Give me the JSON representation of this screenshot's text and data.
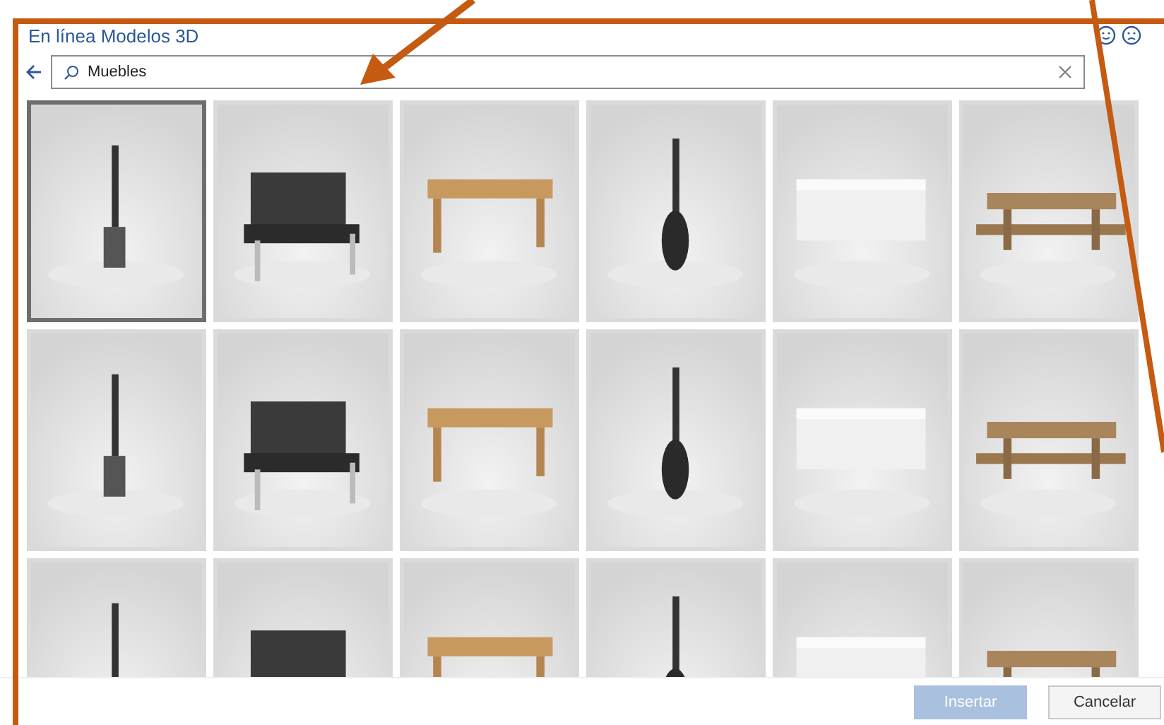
{
  "dialog": {
    "title": "En línea Modelos 3D"
  },
  "search": {
    "value": "Muebles"
  },
  "tiles": [
    {
      "kind": "picture",
      "selected": true
    },
    {
      "kind": "picture",
      "selected": false
    },
    {
      "kind": "picture",
      "selected": false
    },
    {
      "kind": "picture",
      "selected": false
    },
    {
      "kind": "picture",
      "selected": false
    },
    {
      "kind": "picture",
      "selected": false
    },
    {
      "kind": "picture",
      "selected": false
    },
    {
      "kind": "picture",
      "selected": false
    },
    {
      "kind": "picture",
      "selected": false
    },
    {
      "kind": "picture",
      "selected": false
    },
    {
      "kind": "picture",
      "selected": false
    },
    {
      "kind": "picture",
      "selected": false
    },
    {
      "kind": "picture",
      "selected": false
    },
    {
      "kind": "picture",
      "selected": false
    },
    {
      "kind": "picture",
      "selected": false
    },
    {
      "kind": "picture",
      "selected": false
    },
    {
      "kind": "picture",
      "selected": false
    },
    {
      "kind": "picture",
      "selected": false
    }
  ],
  "buttons": [
    {
      "label": "Insertar",
      "disabled": true
    },
    {
      "label": "Cancelar",
      "disabled": false
    }
  ]
}
